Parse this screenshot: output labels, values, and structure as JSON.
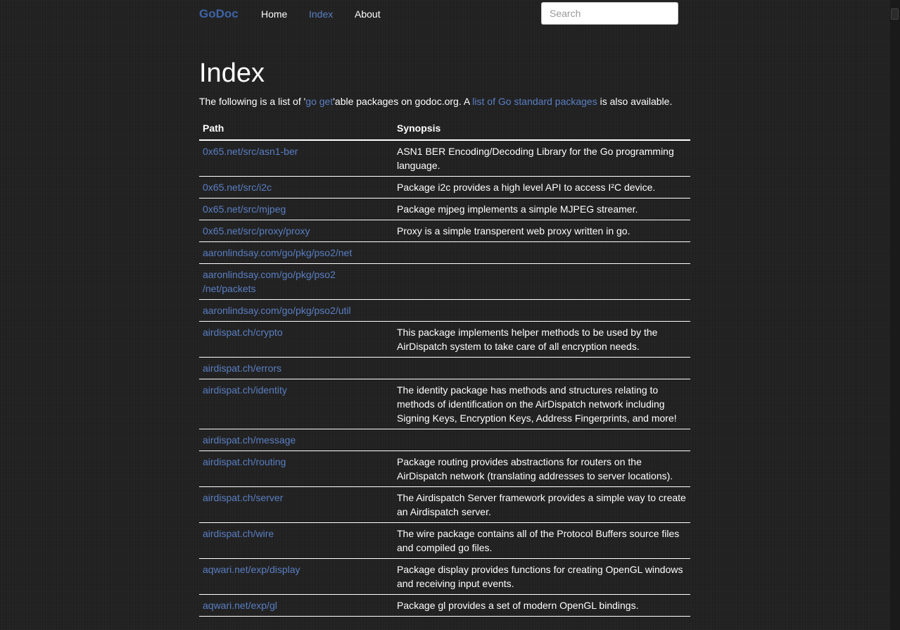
{
  "nav": {
    "brand": "GoDoc",
    "links": [
      "Home",
      "Index",
      "About"
    ],
    "active": "Index",
    "search_placeholder": "Search"
  },
  "page": {
    "title": "Index",
    "intro_1": "The following is a list of '",
    "intro_link_1": "go get",
    "intro_2": "'able packages on godoc.org. A ",
    "intro_link_2": "list of Go standard packages",
    "intro_3": " is also available."
  },
  "table": {
    "headers": [
      "Path",
      "Synopsis"
    ],
    "rows": [
      {
        "path": "0x65.net/src/asn1-ber",
        "synopsis": "ASN1 BER Encoding/Decoding Library for the Go programming language."
      },
      {
        "path": "0x65.net/src/i2c",
        "synopsis": "Package i2c provides a high level API to access I²C device."
      },
      {
        "path": "0x65.net/src/mjpeg",
        "synopsis": "Package mjpeg implements a simple MJPEG streamer."
      },
      {
        "path": "0x65.net/src/proxy/proxy",
        "synopsis": "Proxy is a simple transperent web proxy written in go."
      },
      {
        "path": "aaronlindsay.com/go/pkg/pso2/net",
        "synopsis": ""
      },
      {
        "path": "aaronlindsay.com/go/pkg/pso2\n/net/packets",
        "synopsis": ""
      },
      {
        "path": "aaronlindsay.com/go/pkg/pso2/util",
        "synopsis": ""
      },
      {
        "path": "airdispat.ch/crypto",
        "synopsis": "This package implements helper methods to be used by the AirDispatch system to take care of all encryption needs."
      },
      {
        "path": "airdispat.ch/errors",
        "synopsis": ""
      },
      {
        "path": "airdispat.ch/identity",
        "synopsis": "The identity package has methods and structures relating to methods of identification on the AirDispatch network including Signing Keys, Encryption Keys, Address Fingerprints, and more!"
      },
      {
        "path": "airdispat.ch/message",
        "synopsis": ""
      },
      {
        "path": "airdispat.ch/routing",
        "synopsis": "Package routing provides abstractions for routers on the AirDispatch network (translating addresses to server locations)."
      },
      {
        "path": "airdispat.ch/server",
        "synopsis": "The Airdispatch Server framework provides a simple way to create an Airdispatch server."
      },
      {
        "path": "airdispat.ch/wire",
        "synopsis": "The wire package contains all of the Protocol Buffers source files and compiled go files."
      },
      {
        "path": "aqwari.net/exp/display",
        "synopsis": "Package display provides functions for creating OpenGL windows and receiving input events."
      },
      {
        "path": "aqwari.net/exp/gl",
        "synopsis": "Package gl provides a set of modern OpenGL bindings."
      }
    ]
  },
  "colors": {
    "link": "#5a7fc4",
    "brand": "#3d64a8",
    "background": "#222222",
    "text": "#ffffff"
  }
}
